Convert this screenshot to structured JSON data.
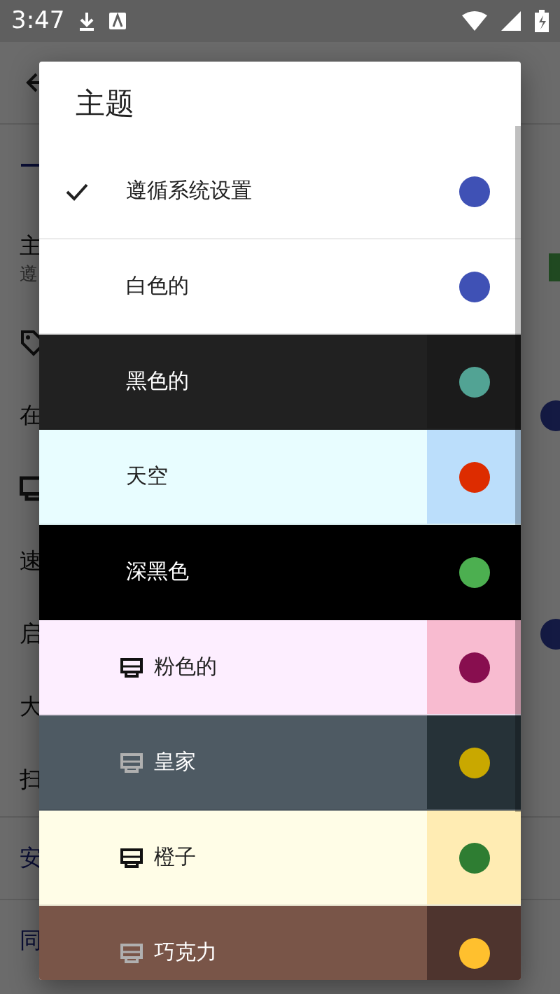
{
  "status_bar": {
    "time": "3:47"
  },
  "background_page": {
    "rows": [
      {
        "kind": "setting",
        "text": "主",
        "subtitle": "遵"
      },
      {
        "kind": "tag_icon"
      },
      {
        "kind": "setting",
        "text": "在",
        "switch_on": true
      },
      {
        "kind": "monitor_icon"
      },
      {
        "kind": "setting",
        "text": "速"
      },
      {
        "kind": "setting",
        "text": "启",
        "switch_on": true
      },
      {
        "kind": "setting",
        "text": "大"
      },
      {
        "kind": "setting",
        "text": "扫"
      },
      {
        "kind": "header",
        "text": "安"
      },
      {
        "kind": "header",
        "text": "同"
      }
    ]
  },
  "theme_dialog": {
    "title": "主题",
    "options": [
      {
        "label": "遵循系统设置",
        "selected": true,
        "premium": false,
        "fill": {
          "color": "#ffffff"
        },
        "accent": {
          "color": "#ffffff"
        },
        "color": "#3f51b5"
      },
      {
        "label": "白色的",
        "selected": false,
        "premium": false,
        "fill": {
          "color": "#ffffff"
        },
        "accent": {
          "color": "#ffffff"
        },
        "color": "#3f51b5"
      },
      {
        "label": "黑色的",
        "selected": false,
        "premium": false,
        "fill": {
          "color": "#212121"
        },
        "accent": {
          "color": "#1b1b1b"
        },
        "color": "#52a394"
      },
      {
        "label": "天空",
        "selected": false,
        "premium": false,
        "fill": {
          "color": "#e8fdff"
        },
        "accent": {
          "color": "#bbdefb"
        },
        "color": "#dd2c00"
      },
      {
        "label": "深黑色",
        "selected": false,
        "premium": false,
        "fill": {
          "color": "#000000"
        },
        "accent": {
          "color": "#000000"
        },
        "color": "#4caf50"
      },
      {
        "label": "粉色的",
        "selected": false,
        "premium": true,
        "fill": {
          "color": "#fdeeff"
        },
        "accent": {
          "color": "#f8bbd0"
        },
        "color": "#880e4f"
      },
      {
        "label": "皇家",
        "selected": false,
        "premium": true,
        "fill": {
          "color": "#4e5a63"
        },
        "accent": {
          "color": "#263238"
        },
        "color": "#c9a800"
      },
      {
        "label": "橙子",
        "selected": false,
        "premium": true,
        "fill": {
          "color": "#fffde7"
        },
        "accent": {
          "color": "#ffecb3"
        },
        "color": "#2e7d32"
      },
      {
        "label": "巧克力",
        "selected": false,
        "premium": true,
        "fill": {
          "color": "#795548"
        },
        "accent": {
          "color": "#4e342e"
        },
        "color": "#ffc02e"
      }
    ]
  }
}
